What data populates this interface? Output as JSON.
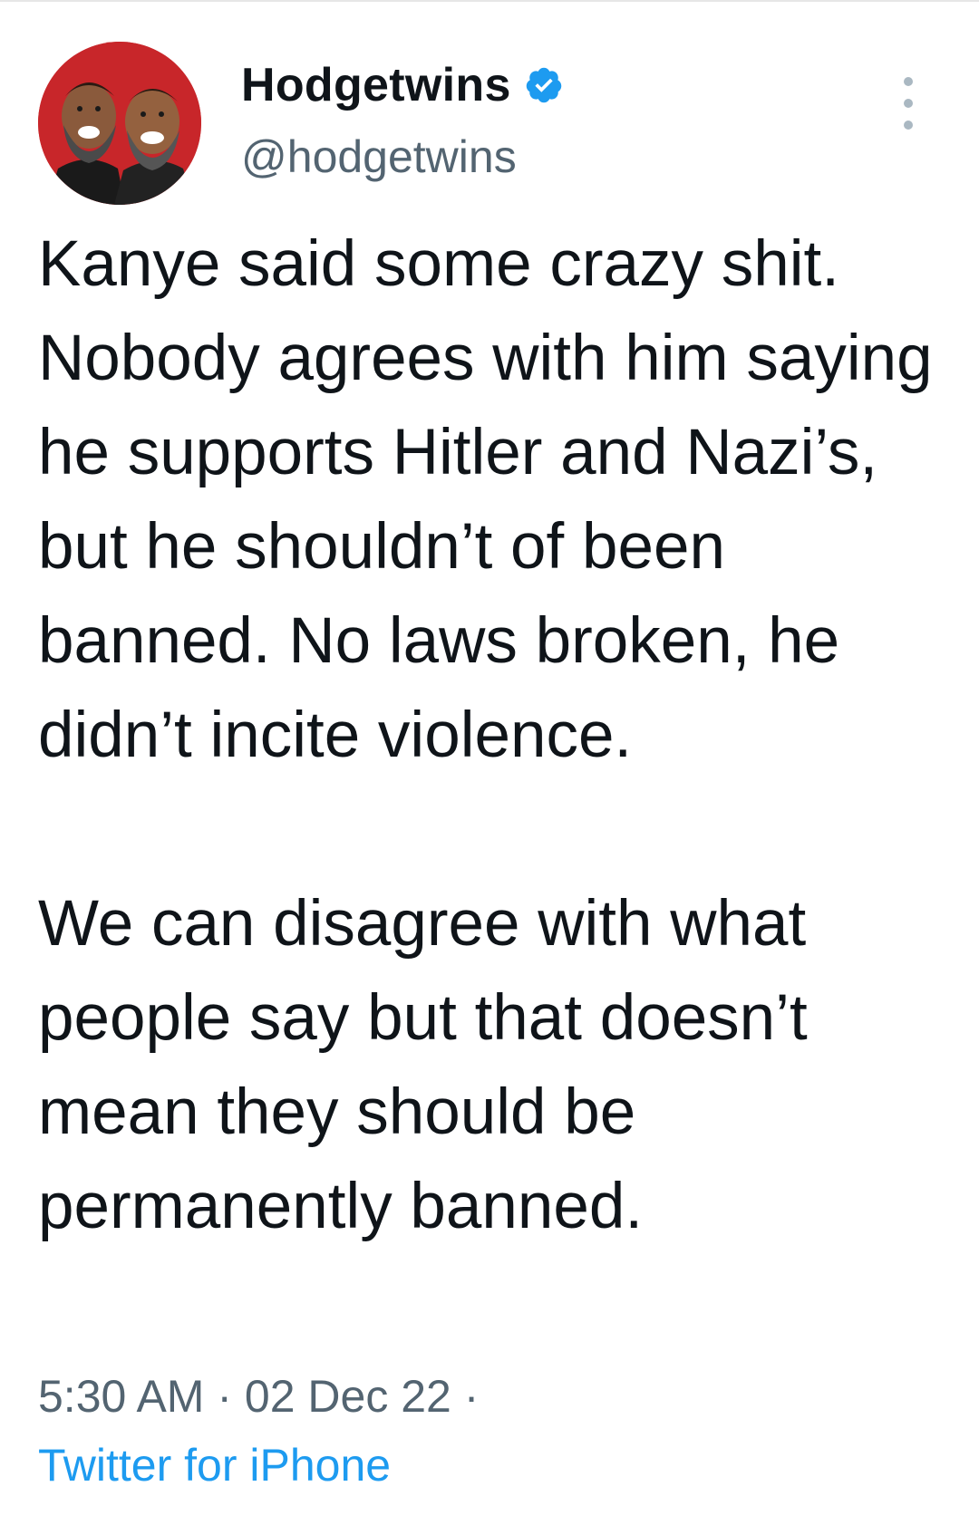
{
  "tweet": {
    "author": {
      "display_name": "Hodgetwins",
      "handle": "@hodgetwins",
      "verified": true,
      "avatar_icon": "profile-photo-twins"
    },
    "text": "Kanye said some crazy shit. Nobody agrees with him saying he supports Hitler and Nazi’s, but he shouldn’t of been banned. No laws broken, he didn’t incite violence.\n\nWe can disagree with what people say but that doesn’t mean they should be permanently banned.",
    "time": "5:30 AM",
    "date": "02 Dec 22",
    "separator": "·",
    "source": "Twitter for iPhone"
  },
  "colors": {
    "text_primary": "#0f1419",
    "text_secondary": "#536471",
    "link": "#1d9bf0",
    "verified_badge": "#1d9bf0",
    "avatar_background": "#c8262a"
  },
  "icons": {
    "verified": "verified-badge-icon",
    "more": "more-vertical-icon"
  }
}
